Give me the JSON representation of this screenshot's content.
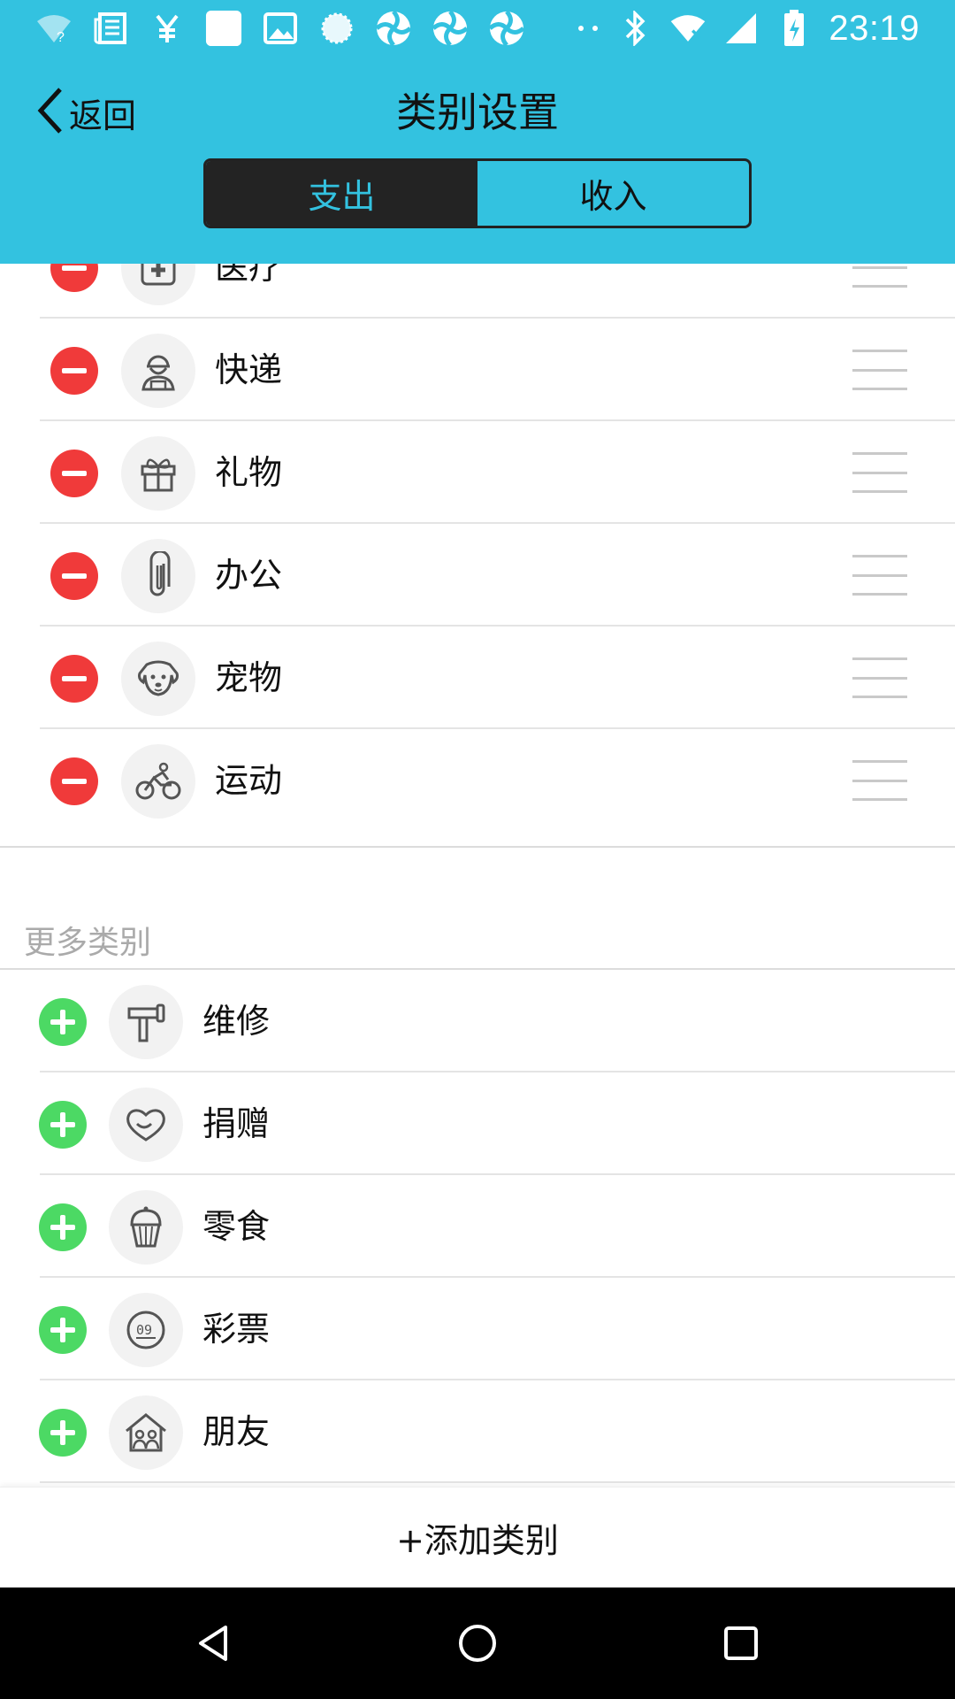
{
  "status_bar": {
    "time": "23:19",
    "left_icons": [
      "wifi-question-icon",
      "news-icon",
      "yen-icon",
      "square-app-icon",
      "image-icon",
      "loading-circle-icon",
      "app-swirl-icon",
      "app-swirl-icon",
      "app-swirl-icon",
      "more-dots-icon"
    ],
    "right_icons": [
      "bluetooth-icon",
      "wifi-off-icon",
      "signal-icon",
      "battery-charging-icon"
    ]
  },
  "header": {
    "back_label": "返回",
    "title": "类别设置",
    "tabs": [
      {
        "label": "支出",
        "active": true
      },
      {
        "label": "收入",
        "active": false
      }
    ],
    "accent_color": "#33c2e0"
  },
  "current_categories": [
    {
      "label": "医疗",
      "icon": "medical-kit-icon"
    },
    {
      "label": "快递",
      "icon": "courier-icon"
    },
    {
      "label": "礼物",
      "icon": "gift-icon"
    },
    {
      "label": "办公",
      "icon": "paperclip-icon"
    },
    {
      "label": "宠物",
      "icon": "dog-face-icon"
    },
    {
      "label": "运动",
      "icon": "bicycle-icon"
    }
  ],
  "more_section": {
    "title": "更多类别",
    "items": [
      {
        "label": "维修",
        "icon": "hammer-icon"
      },
      {
        "label": "捐赠",
        "icon": "heart-hand-icon"
      },
      {
        "label": "零食",
        "icon": "cupcake-icon"
      },
      {
        "label": "彩票",
        "icon": "lottery-ball-icon"
      },
      {
        "label": "朋友",
        "icon": "friends-house-icon"
      }
    ]
  },
  "add_button_label": "+添加类别",
  "colors": {
    "remove": "#f03a3a",
    "add": "#4cd964",
    "header_bg": "#33c2e0"
  },
  "nav": [
    "back-triangle-icon",
    "home-circle-icon",
    "recents-square-icon"
  ]
}
